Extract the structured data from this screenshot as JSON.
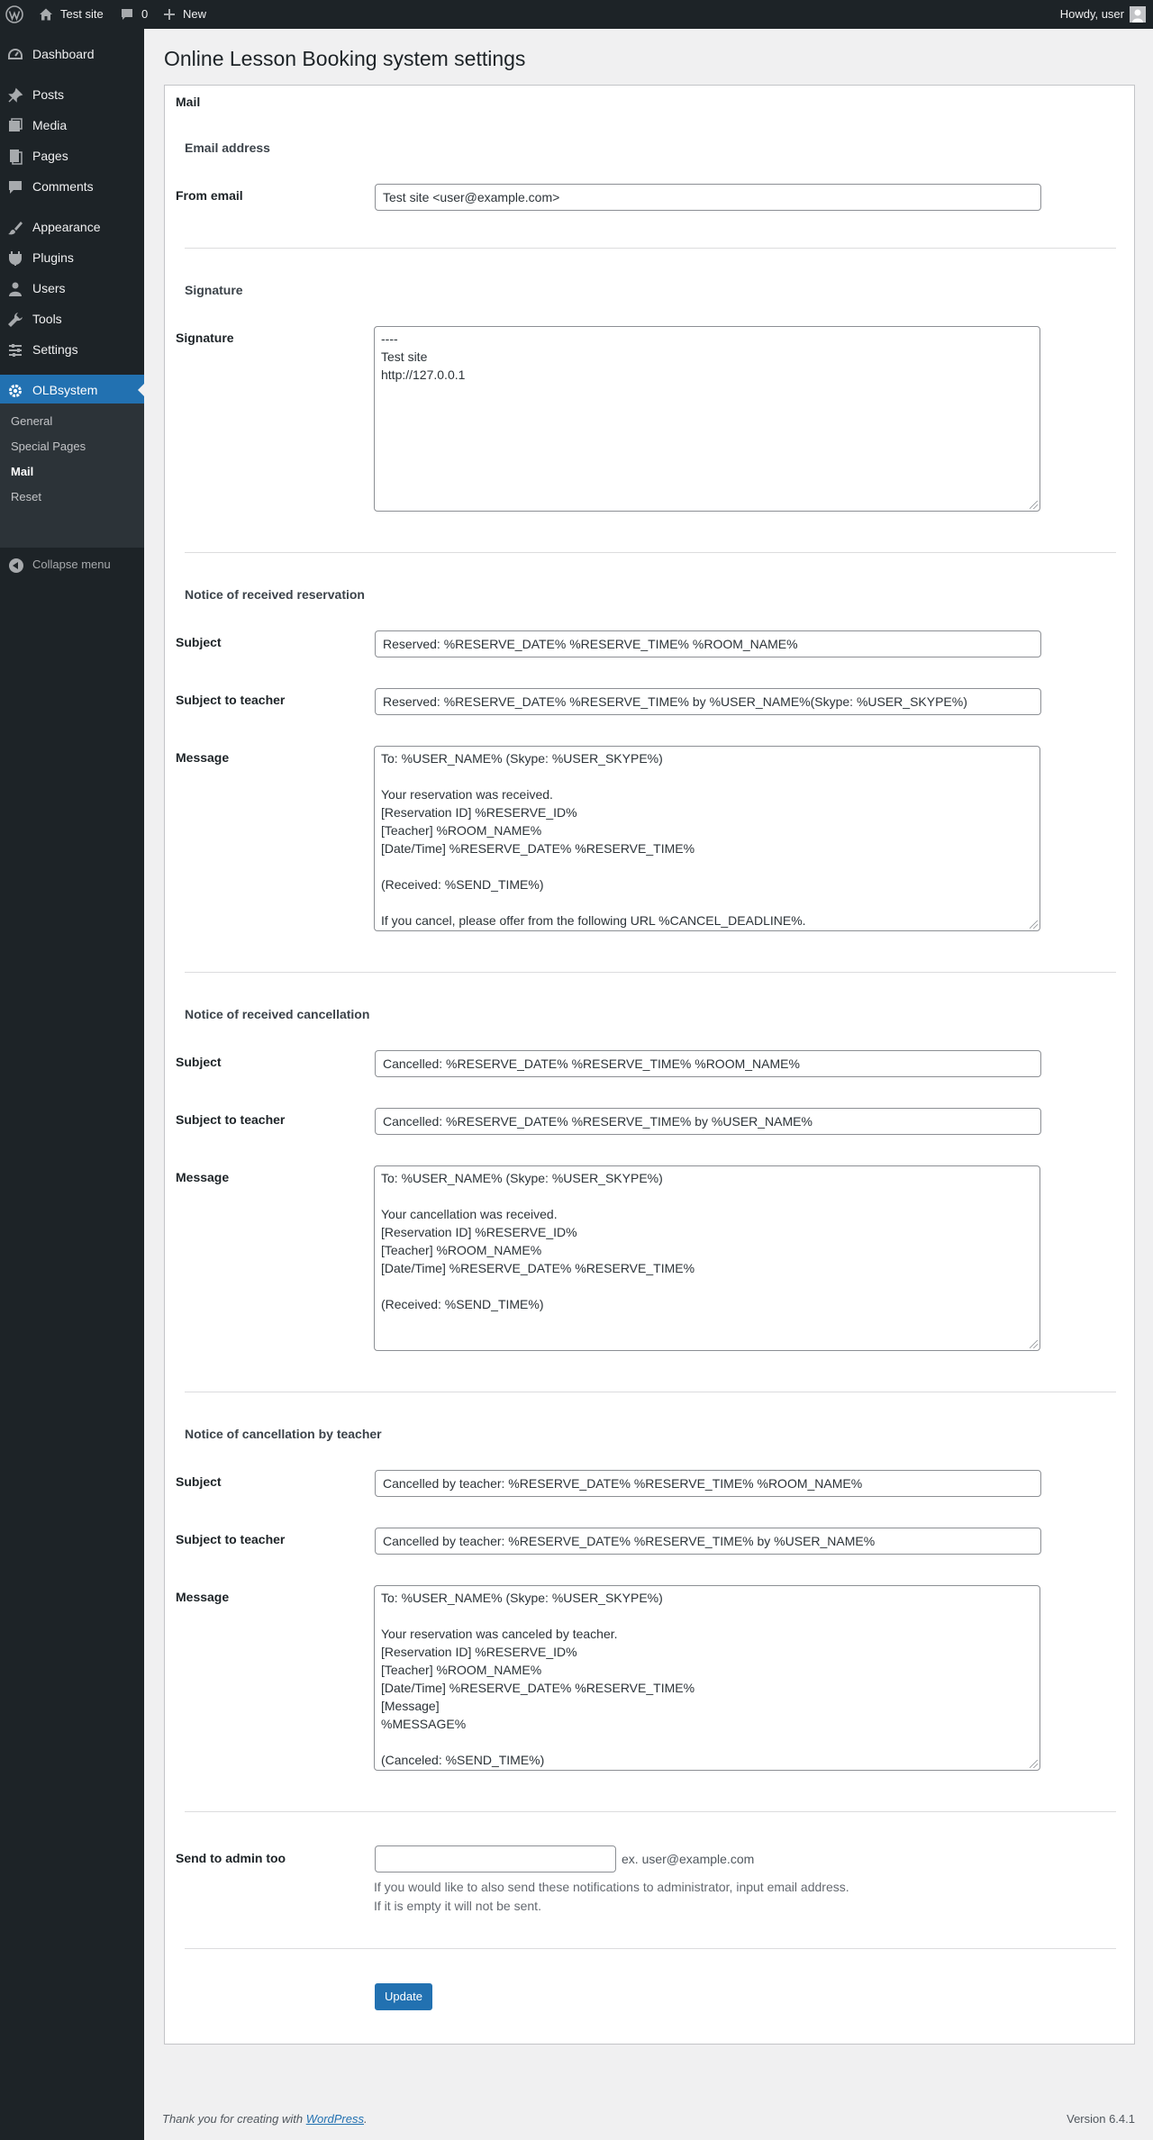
{
  "adminbar": {
    "site_name": "Test site",
    "comments_count": "0",
    "new_label": "New",
    "howdy": "Howdy, user"
  },
  "sidebar": {
    "items": [
      {
        "label": "Dashboard",
        "icon": "dashboard-icon"
      },
      {
        "label": "Posts",
        "icon": "pin-icon"
      },
      {
        "label": "Media",
        "icon": "media-icon"
      },
      {
        "label": "Pages",
        "icon": "page-icon"
      },
      {
        "label": "Comments",
        "icon": "comment-icon"
      },
      {
        "label": "Appearance",
        "icon": "brush-icon"
      },
      {
        "label": "Plugins",
        "icon": "plug-icon"
      },
      {
        "label": "Users",
        "icon": "user-icon"
      },
      {
        "label": "Tools",
        "icon": "wrench-icon"
      },
      {
        "label": "Settings",
        "icon": "settings-icon"
      },
      {
        "label": "OLBsystem",
        "icon": "gear-icon"
      }
    ],
    "submenu": [
      "General",
      "Special Pages",
      "Mail",
      "Reset"
    ],
    "collapse": "Collapse menu"
  },
  "page_title": "Online Lesson Booking system settings",
  "card_title": "Mail",
  "email_section": {
    "heading": "Email address",
    "from_label": "From email",
    "from_value": "Test site <user@example.com>"
  },
  "signature_section": {
    "heading": "Signature",
    "label": "Signature",
    "value": "----\nTest site\nhttp://127.0.0.1"
  },
  "reservation_section": {
    "heading": "Notice of received reservation",
    "subject_label": "Subject",
    "subject_value": "Reserved: %RESERVE_DATE% %RESERVE_TIME% %ROOM_NAME%",
    "teacher_label": "Subject to teacher",
    "teacher_value": "Reserved: %RESERVE_DATE% %RESERVE_TIME% by %USER_NAME%(Skype: %USER_SKYPE%)",
    "message_label": "Message",
    "message_value": "To: %USER_NAME% (Skype: %USER_SKYPE%)\n\nYour reservation was received.\n[Reservation ID] %RESERVE_ID%\n[Teacher] %ROOM_NAME%\n[Date/Time] %RESERVE_DATE% %RESERVE_TIME%\n\n(Received: %SEND_TIME%)\n\nIf you cancel, please offer from the following URL %CANCEL_DEADLINE%."
  },
  "cancellation_section": {
    "heading": "Notice of received cancellation",
    "subject_label": "Subject",
    "subject_value": "Cancelled: %RESERVE_DATE% %RESERVE_TIME% %ROOM_NAME%",
    "teacher_label": "Subject to teacher",
    "teacher_value": "Cancelled: %RESERVE_DATE% %RESERVE_TIME% by %USER_NAME%",
    "message_label": "Message",
    "message_value": "To: %USER_NAME% (Skype: %USER_SKYPE%)\n\nYour cancellation was received.\n[Reservation ID] %RESERVE_ID%\n[Teacher] %ROOM_NAME%\n[Date/Time] %RESERVE_DATE% %RESERVE_TIME%\n\n(Received: %SEND_TIME%)"
  },
  "teacher_cancel_section": {
    "heading": "Notice of cancellation by teacher",
    "subject_label": "Subject",
    "subject_value": "Cancelled by teacher: %RESERVE_DATE% %RESERVE_TIME% %ROOM_NAME%",
    "teacher_label": "Subject to teacher",
    "teacher_value": "Cancelled by teacher: %RESERVE_DATE% %RESERVE_TIME% by %USER_NAME%",
    "message_label": "Message",
    "message_value": "To: %USER_NAME% (Skype: %USER_SKYPE%)\n\nYour reservation was canceled by teacher.\n[Reservation ID] %RESERVE_ID%\n[Teacher] %ROOM_NAME%\n[Date/Time] %RESERVE_DATE% %RESERVE_TIME%\n[Message]\n%MESSAGE%\n\n(Canceled: %SEND_TIME%)"
  },
  "admin_section": {
    "label": "Send to admin too",
    "value": "",
    "example": "ex. user@example.com",
    "desc_line1": "If you would like to also send these notifications to administrator, input email address.",
    "desc_line2": "If it is empty it will not be sent."
  },
  "update_button": "Update",
  "footer": {
    "thanks_prefix": "Thank you for creating with ",
    "thanks_link": "WordPress",
    "thanks_suffix": ".",
    "version": "Version 6.4.1"
  },
  "colors": {
    "accent": "#2271b1",
    "sidebar_bg": "#1d2327"
  }
}
